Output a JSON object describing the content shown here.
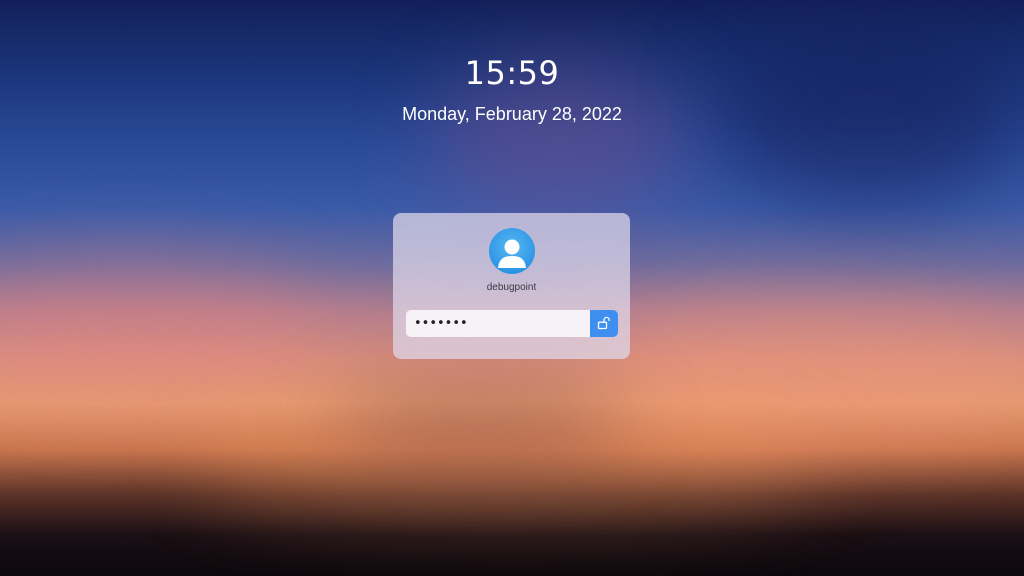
{
  "lock_screen": {
    "time": "15:59",
    "date": "Monday, February 28, 2022"
  },
  "login": {
    "username": "debugpoint",
    "password_value": "•••••••",
    "avatar_icon": "user-avatar-icon",
    "unlock_icon": "unlock-icon"
  },
  "colors": {
    "accent": "#3f8ff0",
    "avatar": "#2d96e4"
  }
}
